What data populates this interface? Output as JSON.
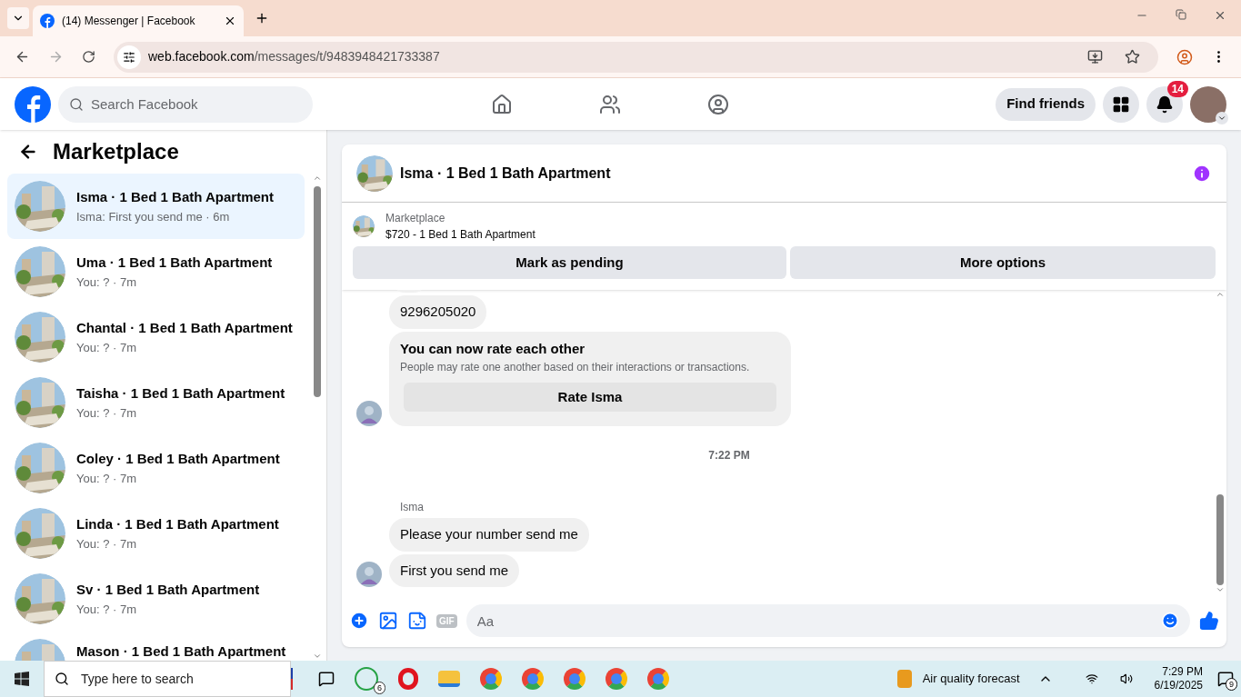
{
  "browser": {
    "tab_title": "(14) Messenger | Facebook",
    "url_host": "web.facebook.com",
    "url_path": "/messages/t/9483948421733387"
  },
  "header": {
    "search_placeholder": "Search Facebook",
    "find_friends": "Find friends",
    "notification_count": "14"
  },
  "sidebar": {
    "title": "Marketplace",
    "conversations": [
      {
        "title": "Isma · 1 Bed 1 Bath Apartment",
        "preview": "Isma: First you send me · 6m",
        "selected": true
      },
      {
        "title": "Uma · 1 Bed 1 Bath Apartment",
        "preview": "You: ? · 7m",
        "selected": false
      },
      {
        "title": "Chantal · 1 Bed 1 Bath Apartment",
        "preview": "You: ? · 7m",
        "selected": false
      },
      {
        "title": "Taisha · 1 Bed 1 Bath Apartment",
        "preview": "You: ? · 7m",
        "selected": false
      },
      {
        "title": "Coley · 1 Bed 1 Bath Apartment",
        "preview": "You: ? · 7m",
        "selected": false
      },
      {
        "title": "Linda · 1 Bed 1 Bath Apartment",
        "preview": "You: ? · 7m",
        "selected": false
      },
      {
        "title": "Sv · 1 Bed 1 Bath Apartment",
        "preview": "You: ? · 7m",
        "selected": false
      },
      {
        "title": "Mason · 1 Bed 1 Bath Apartment",
        "selected": false
      }
    ]
  },
  "chat": {
    "title": "Isma · 1 Bed 1 Bath Apartment",
    "listing_label": "Marketplace",
    "listing": "$720 - 1 Bed 1 Bath Apartment",
    "actions": [
      "Mark as pending",
      "More options"
    ],
    "messages": [
      {
        "kind": "partial"
      },
      {
        "kind": "bubble",
        "text": "9296205020"
      },
      {
        "kind": "rating",
        "title": "You can now rate each other",
        "body": "People may rate one another based on their interactions or transactions.",
        "button": "Rate Isma"
      },
      {
        "kind": "time",
        "text": "7:22 PM"
      },
      {
        "kind": "sender",
        "text": "Isma"
      },
      {
        "kind": "bubble",
        "text": "Please your number send me"
      },
      {
        "kind": "bubble",
        "text": "First you send me"
      }
    ],
    "composer_placeholder": "Aa",
    "gif_label": "GIF"
  },
  "taskbar": {
    "search_placeholder": "Type here to search",
    "whatsapp_badge": "6",
    "weather": "Air quality forecast",
    "time": "7:29 PM",
    "date": "6/19/2025",
    "notifications": "9"
  }
}
